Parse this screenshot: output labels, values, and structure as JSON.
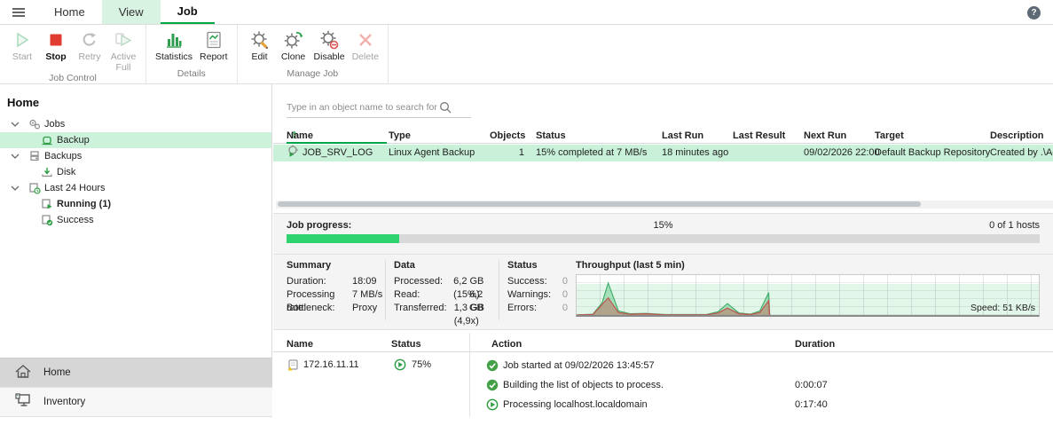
{
  "tabs": {
    "home": "Home",
    "view": "View",
    "job": "Job"
  },
  "help": {
    "glyph": "?"
  },
  "ribbon": {
    "job_control": {
      "label": "Job Control",
      "start": "Start",
      "stop": "Stop",
      "retry": "Retry",
      "active_full_line1": "Active",
      "active_full_line2": "Full"
    },
    "details": {
      "label": "Details",
      "statistics": "Statistics",
      "report": "Report"
    },
    "manage_job": {
      "label": "Manage Job",
      "edit": "Edit",
      "clone": "Clone",
      "disable": "Disable",
      "delete": "Delete"
    }
  },
  "sidebar": {
    "title": "Home",
    "tree": [
      {
        "label": "Jobs"
      },
      {
        "label": "Backup"
      },
      {
        "label": "Backups"
      },
      {
        "label": "Disk"
      },
      {
        "label": "Last 24 Hours"
      },
      {
        "label": "Running (1)"
      },
      {
        "label": "Success"
      }
    ],
    "nav": [
      {
        "label": "Home"
      },
      {
        "label": "Inventory"
      }
    ]
  },
  "search": {
    "placeholder": "Type in an object name to search for"
  },
  "jobs_table": {
    "columns": {
      "name": "Name",
      "type": "Type",
      "objects": "Objects",
      "status": "Status",
      "last_run": "Last Run",
      "last_result": "Last Result",
      "next_run": "Next Run",
      "target": "Target",
      "description": "Description"
    },
    "row": {
      "name": "JOB_SRV_LOG",
      "type": "Linux Agent Backup",
      "objects": "1",
      "status": "15% completed at 7 MB/s",
      "last_run": "18 minutes ago",
      "last_result": "",
      "next_run": "09/02/2026 22:00",
      "target": "Default Backup Repository",
      "description": "Created by .\\Adm"
    }
  },
  "progress": {
    "label": "Job progress:",
    "percent": "15%",
    "hosts": "0 of 1 hosts",
    "fill_percent": 15
  },
  "summary": {
    "title": "Summary",
    "duration_label": "Duration:",
    "duration": "18:09",
    "rate_label": "Processing rate:",
    "rate": "7 MB/s",
    "bottleneck_label": "Bottleneck:",
    "bottleneck": "Proxy"
  },
  "data_panel": {
    "title": "Data",
    "processed_label": "Processed:",
    "processed": "6,2 GB (15%)",
    "read_label": "Read:",
    "read": "6,2 GB",
    "transferred_label": "Transferred:",
    "transferred": "1,3 GB (4,9x)"
  },
  "status_panel": {
    "title": "Status",
    "success_label": "Success:",
    "success": "0",
    "warnings_label": "Warnings:",
    "warnings": "0",
    "errors_label": "Errors:",
    "errors": "0"
  },
  "chart_data": {
    "type": "area",
    "title": "Throughput (last 5 min)",
    "annotation": "Speed: 51 KB/s",
    "x_range": [
      0,
      1
    ],
    "y_range": [
      0,
      1
    ],
    "grid": true,
    "series": [
      {
        "name": "series-1",
        "color": "#3fae6a",
        "fill": "rgba(90,200,130,0.45)",
        "points": [
          [
            0,
            0
          ],
          [
            0.035,
            0.02
          ],
          [
            0.055,
            0.3
          ],
          [
            0.068,
            0.78
          ],
          [
            0.09,
            0.1
          ],
          [
            0.115,
            0.03
          ],
          [
            0.15,
            0.04
          ],
          [
            0.19,
            0.01
          ],
          [
            0.28,
            0.01
          ],
          [
            0.305,
            0.08
          ],
          [
            0.325,
            0.28
          ],
          [
            0.35,
            0.05
          ],
          [
            0.375,
            0.02
          ],
          [
            0.395,
            0.1
          ],
          [
            0.414,
            0.55
          ],
          [
            0.416,
            0
          ]
        ]
      },
      {
        "name": "series-2",
        "color": "#bf5450",
        "fill": "rgba(190,95,85,0.45)",
        "points": [
          [
            0,
            0
          ],
          [
            0.035,
            0.01
          ],
          [
            0.068,
            0.42
          ],
          [
            0.09,
            0.06
          ],
          [
            0.115,
            0.02
          ],
          [
            0.15,
            0.03
          ],
          [
            0.19,
            0.005
          ],
          [
            0.28,
            0.005
          ],
          [
            0.305,
            0.05
          ],
          [
            0.325,
            0.17
          ],
          [
            0.35,
            0.03
          ],
          [
            0.375,
            0.01
          ],
          [
            0.395,
            0.06
          ],
          [
            0.414,
            0.35
          ],
          [
            0.416,
            0
          ]
        ]
      }
    ]
  },
  "details_table": {
    "columns": {
      "name": "Name",
      "status": "Status",
      "action": "Action",
      "duration": "Duration"
    },
    "host": {
      "name": "172.16.11.11",
      "status": "75%"
    },
    "actions": [
      {
        "text": "Job started at 09/02/2026 13:45:57",
        "duration": ""
      },
      {
        "text": "Building the list of objects to process.",
        "duration": "0:00:07"
      },
      {
        "text": "Processing localhost.localdomain",
        "duration": "0:17:40"
      }
    ]
  },
  "colors": {
    "accent_green": "#00a64a",
    "selection_green": "#c9f0d8",
    "progress_green": "#2ed36f",
    "stop_red": "#e03c31"
  }
}
